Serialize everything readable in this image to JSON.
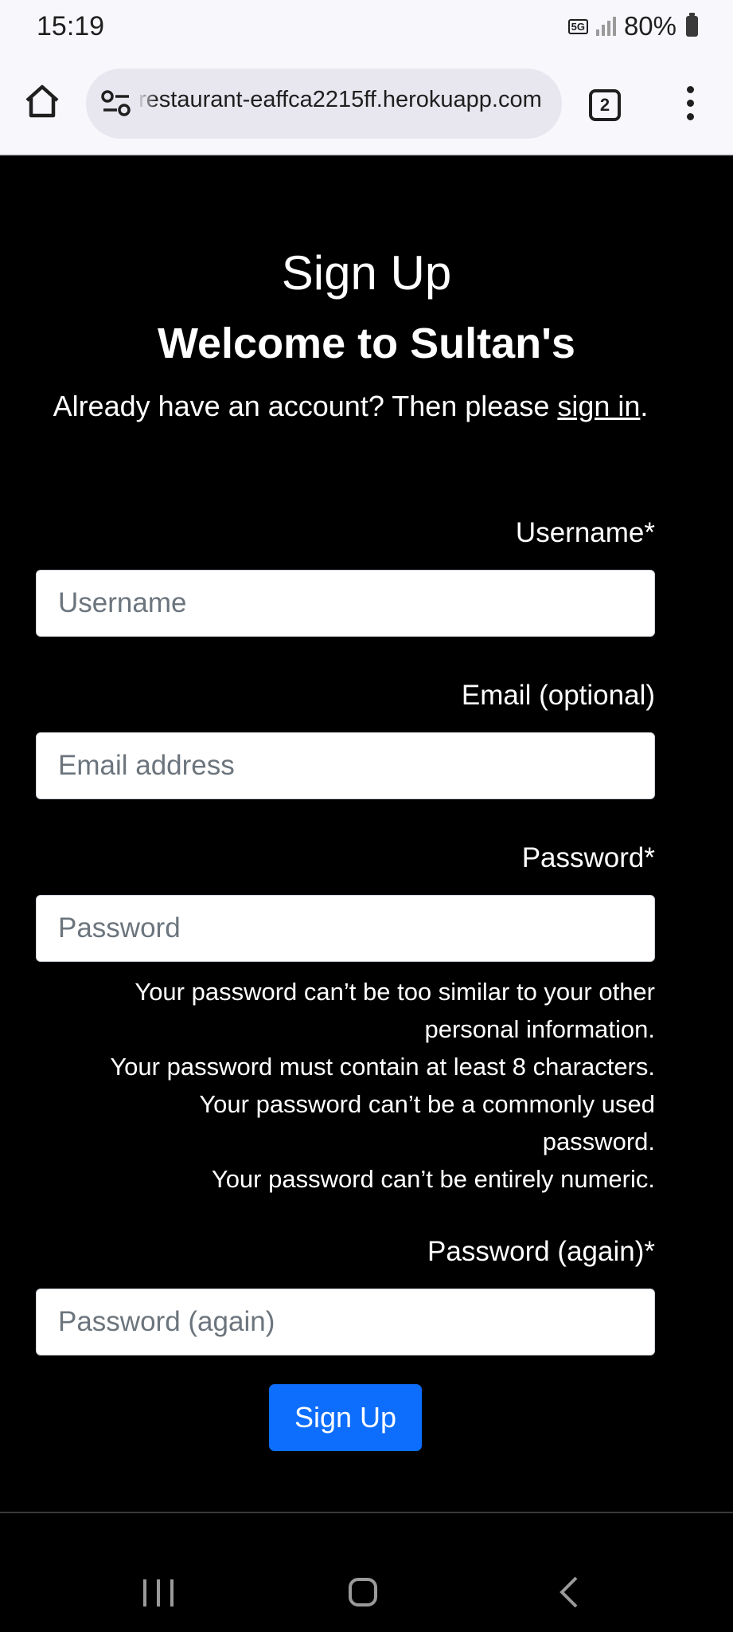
{
  "status_bar": {
    "time": "15:19",
    "network": "5G",
    "battery": "80%"
  },
  "browser": {
    "url": "restaurant-eaffca2215ff.herokuapp.com",
    "tab_count": "2"
  },
  "page": {
    "title": "Sign Up",
    "subtitle": "Welcome to Sultan's",
    "intro_prefix": "Already have an account? Then please ",
    "intro_link": "sign in",
    "intro_suffix": "."
  },
  "form": {
    "username": {
      "label": "Username*",
      "placeholder": "Username",
      "value": ""
    },
    "email": {
      "label": "Email (optional)",
      "placeholder": "Email address",
      "value": ""
    },
    "password": {
      "label": "Password*",
      "placeholder": "Password",
      "value": ""
    },
    "password_help": [
      "Your password can’t be too similar to your other personal information.",
      "Your password must contain at least 8 characters.",
      "Your password can’t be a commonly used password.",
      "Your password can’t be entirely numeric."
    ],
    "password_again": {
      "label": "Password (again)*",
      "placeholder": "Password (again)",
      "value": ""
    },
    "submit_label": "Sign Up"
  },
  "colors": {
    "page_background": "#000000",
    "primary_button": "#0d6efd",
    "browser_chrome": "#f8f7fc"
  },
  "icons": {
    "home": "home-icon",
    "site_settings": "tune-icon",
    "tabs": "tab-switcher-icon",
    "menu": "more-vert-icon",
    "nav_recent": "recent-apps-icon",
    "nav_home": "nav-home-icon",
    "nav_back": "back-icon"
  }
}
